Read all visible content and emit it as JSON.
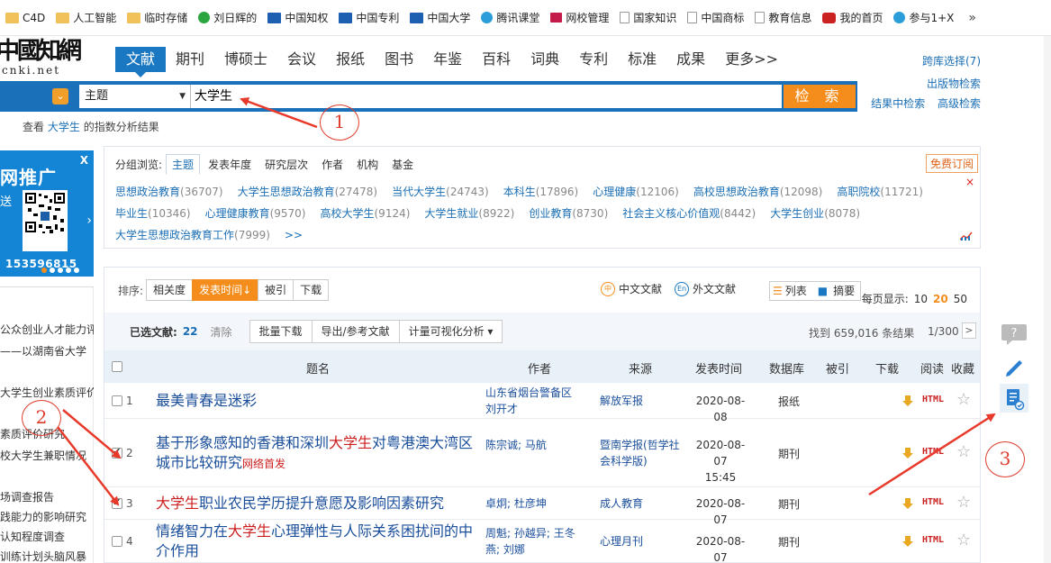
{
  "bookmarks": [
    {
      "label": "C4D",
      "icon": "folder-icon"
    },
    {
      "label": "人工智能",
      "icon": "folder-icon"
    },
    {
      "label": "临时存储",
      "icon": "folder-icon"
    },
    {
      "label": "刘日辉的",
      "icon": "green-logo-icon"
    },
    {
      "label": "中国知权",
      "icon": "site-icon"
    },
    {
      "label": "中国专利",
      "icon": "site-icon"
    },
    {
      "label": "中国大学",
      "icon": "flag-icon"
    },
    {
      "label": "腾讯课堂",
      "icon": "tencent-icon"
    },
    {
      "label": "网校管理",
      "icon": "red-logo-icon"
    },
    {
      "label": "国家知识",
      "icon": "page-icon"
    },
    {
      "label": "中国商标",
      "icon": "page-icon"
    },
    {
      "label": "教育信息",
      "icon": "page-icon"
    },
    {
      "label": "我的首页",
      "icon": "weibo-icon"
    },
    {
      "label": "参与1+X",
      "icon": "cloud-icon"
    }
  ],
  "bookmarks_more": "»",
  "logo": {
    "cn": "中國知網",
    "en": "cnki.net"
  },
  "nav_tabs": [
    "文献",
    "期刊",
    "博硕士",
    "会议",
    "报纸",
    "图书",
    "年鉴",
    "百科",
    "词典",
    "专利",
    "标准",
    "成果",
    "更多>>"
  ],
  "right_links": {
    "cross": "跨库选择(7)",
    "pub": "出版物检索",
    "in_result": "结果中检索",
    "advanced": "高级检索"
  },
  "search": {
    "field": "主题",
    "query": "大学生",
    "button": "检 索"
  },
  "index_hint": {
    "pre": "查看",
    "kw": "大学生",
    "post": "的指数分析结果"
  },
  "ad": {
    "title": "网推广",
    "sub": "送",
    "number": "153596815",
    "close": "X"
  },
  "left_items": [
    "公众创业人才能力评",
    "——以湖南省大学",
    "大学生创业素质评价",
    "素质评价研究",
    "校大学生兼职情况",
    "场调查报告",
    "践能力的影响研究",
    "认知程度调查",
    "训练计划头脑风暴"
  ],
  "filter": {
    "label": "分组浏览:",
    "tabs": [
      "主题",
      "发表年度",
      "研究层次",
      "作者",
      "机构",
      "基金"
    ],
    "subscribe": "免费订阅",
    "close": "×",
    "items": [
      {
        "name": "思想政治教育",
        "count": "(36707)"
      },
      {
        "name": "大学生思想政治教育",
        "count": "(27478)"
      },
      {
        "name": "当代大学生",
        "count": "(24743)"
      },
      {
        "name": "本科生",
        "count": "(17896)"
      },
      {
        "name": "心理健康",
        "count": "(12106)"
      },
      {
        "name": "高校思想政治教育",
        "count": "(12098)"
      },
      {
        "name": "高职院校",
        "count": "(11721)"
      },
      {
        "name": "毕业生",
        "count": "(10346)"
      },
      {
        "name": "心理健康教育",
        "count": "(9570)"
      },
      {
        "name": "高校大学生",
        "count": "(9124)"
      },
      {
        "name": "大学生就业",
        "count": "(8922)"
      },
      {
        "name": "创业教育",
        "count": "(8730)"
      },
      {
        "name": "社会主义核心价值观",
        "count": "(8442)"
      },
      {
        "name": "大学生创业",
        "count": "(8078)"
      },
      {
        "name": "大学生思想政治教育工作",
        "count": "(7999)"
      }
    ],
    "more": ">>"
  },
  "sort": {
    "label": "排序:",
    "options": [
      "相关度",
      "发表时间↓",
      "被引",
      "下载"
    ],
    "active": 1
  },
  "lang": {
    "cn": "中文文献",
    "en": "外文文献",
    "cn_icon": "中",
    "en_icon": "En"
  },
  "view": {
    "list": "列表",
    "abstract": "摘要"
  },
  "per_page": {
    "label": "每页显示:",
    "options": [
      "10",
      "20",
      "50"
    ],
    "active": 1
  },
  "selected": {
    "label": "已选文献:",
    "count": "22",
    "clear": "清除"
  },
  "actions": [
    "批量下载",
    "导出/参考文献",
    "计量可视化分析 ▾"
  ],
  "found": "找到 659,016 条结果",
  "page": "1/300",
  "next": ">",
  "columns": {
    "title": "题名",
    "author": "作者",
    "source": "来源",
    "date": "发表时间",
    "db": "数据库",
    "cited": "被引",
    "download": "下载",
    "read": "阅读",
    "fav": "收藏"
  },
  "rows": [
    {
      "no": "1",
      "title_parts": [
        "最美青春是迷彩"
      ],
      "hl": [
        false
      ],
      "tag": "",
      "author": "山东省烟台警备区 刘开才",
      "source": "解放军报",
      "date": "2020-08-08",
      "time": "",
      "db": "报纸",
      "checked": false
    },
    {
      "no": "2",
      "title_parts": [
        "基于形象感知的香港和深圳",
        "大学生",
        "对粤港澳大湾区城市比较研究"
      ],
      "hl": [
        false,
        true,
        false
      ],
      "tag": "网络首发",
      "author": "陈宗诚; 马航",
      "source": "暨南学报(哲学社会科学版)",
      "date": "2020-08-07",
      "time": "15:45",
      "db": "期刊",
      "checked": true
    },
    {
      "no": "3",
      "title_parts": [
        "大学生",
        "职业农民学历提升意愿及影响因素研究"
      ],
      "hl": [
        true,
        false
      ],
      "tag": "",
      "author": "卓炯; 杜彦坤",
      "source": "成人教育",
      "date": "2020-08-07",
      "time": "",
      "db": "期刊",
      "checked": true
    },
    {
      "no": "4",
      "title_parts": [
        "情绪智力在",
        "大学生",
        "心理弹性与人际关系困扰间的中介作用"
      ],
      "hl": [
        false,
        true,
        false
      ],
      "tag": "",
      "author": "周魁; 孙越异; 王冬燕; 刘娜",
      "source": "心理月刊",
      "date": "2020-08-07",
      "time": "",
      "db": "期刊",
      "checked": false
    }
  ],
  "html_label": "HTML",
  "star": "☆",
  "annotations": [
    "1",
    "2",
    "3"
  ],
  "colors": {
    "brand_blue": "#1b71b9",
    "accent_orange": "#f48d1b",
    "link": "#1a4e9b",
    "highlight_red": "#cc1f1f",
    "annotation_red": "#e03c2c"
  }
}
